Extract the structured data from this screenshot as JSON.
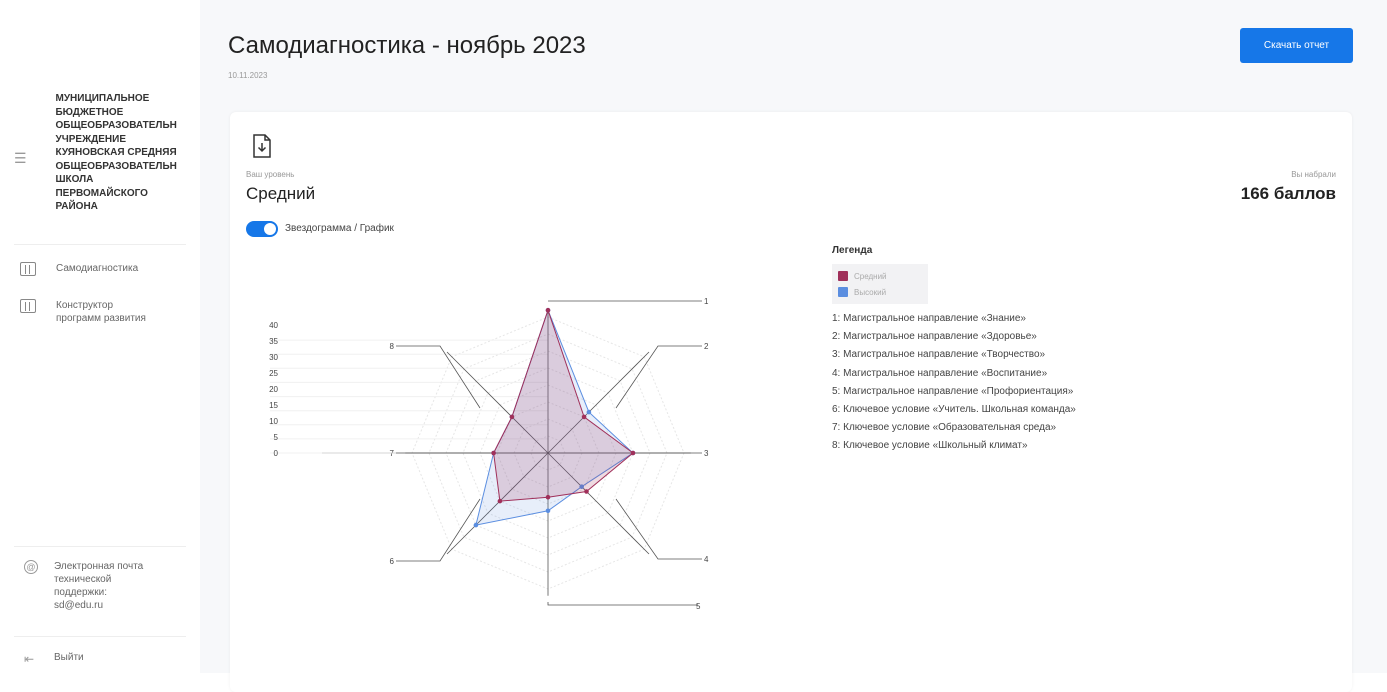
{
  "sidebar": {
    "org_name": "МУНИЦИПАЛЬНОЕ\nБЮДЖЕТНОЕ\nОБЩЕОБРАЗОВАТЕЛЬН\nУЧРЕЖДЕНИЕ\nКУЯНОВСКАЯ СРЕДНЯЯ\nОБЩЕОБРАЗОВАТЕЛЬН\nШКОЛА\nПЕРВОМАЙСКОГО\nРАЙОНА",
    "items": [
      {
        "label": "Самодиагностика"
      },
      {
        "label": "Конструктор\nпрограмм развития"
      }
    ],
    "support": "Электронная почта\nтехнической\nподдержки:\nsd@edu.ru",
    "logout": "Выйти"
  },
  "header": {
    "title": "Самодиагностика - ноябрь 2023",
    "date": "10.11.2023",
    "download_label": "Скачать отчет"
  },
  "summary": {
    "level_label": "Ваш уровень",
    "level_value": "Средний",
    "score_label": "Вы набрали",
    "score_value": "166 баллов",
    "toggle_label": "Звездограмма / График"
  },
  "chart_data": {
    "type": "radar",
    "axes": [
      "1",
      "2",
      "3",
      "4",
      "5",
      "6",
      "7",
      "8"
    ],
    "scale_ticks": [
      "40",
      "35",
      "30",
      "25",
      "20",
      "15",
      "10",
      "5",
      "0"
    ],
    "rmax": 40,
    "series": [
      {
        "name": "Средний",
        "values": [
          42,
          15,
          25,
          16,
          13,
          20,
          16,
          15
        ],
        "color": "#a0305a"
      },
      {
        "name": "Высокий",
        "values": [
          42,
          17,
          25,
          14,
          17,
          30,
          16,
          15
        ],
        "color": "#5b8ee0"
      }
    ]
  },
  "legend": {
    "title": "Легенда",
    "series_names": [
      "Средний",
      "Высокий"
    ],
    "items": [
      "1: Магистральное направление «Знание»",
      "2: Магистральное направление «Здоровье»",
      "3: Магистральное направление «Творчество»",
      "4: Магистральное направление «Воспитание»",
      "5: Магистральное направление «Профориентация»",
      "6: Ключевое условие «Учитель. Школьная команда»",
      "7: Ключевое условие «Образовательная среда»",
      "8: Ключевое условие «Школьный климат»"
    ]
  },
  "colors": {
    "accent": "#1677e8",
    "series_1": "#a0305a",
    "series_2": "#5b8ee0"
  }
}
